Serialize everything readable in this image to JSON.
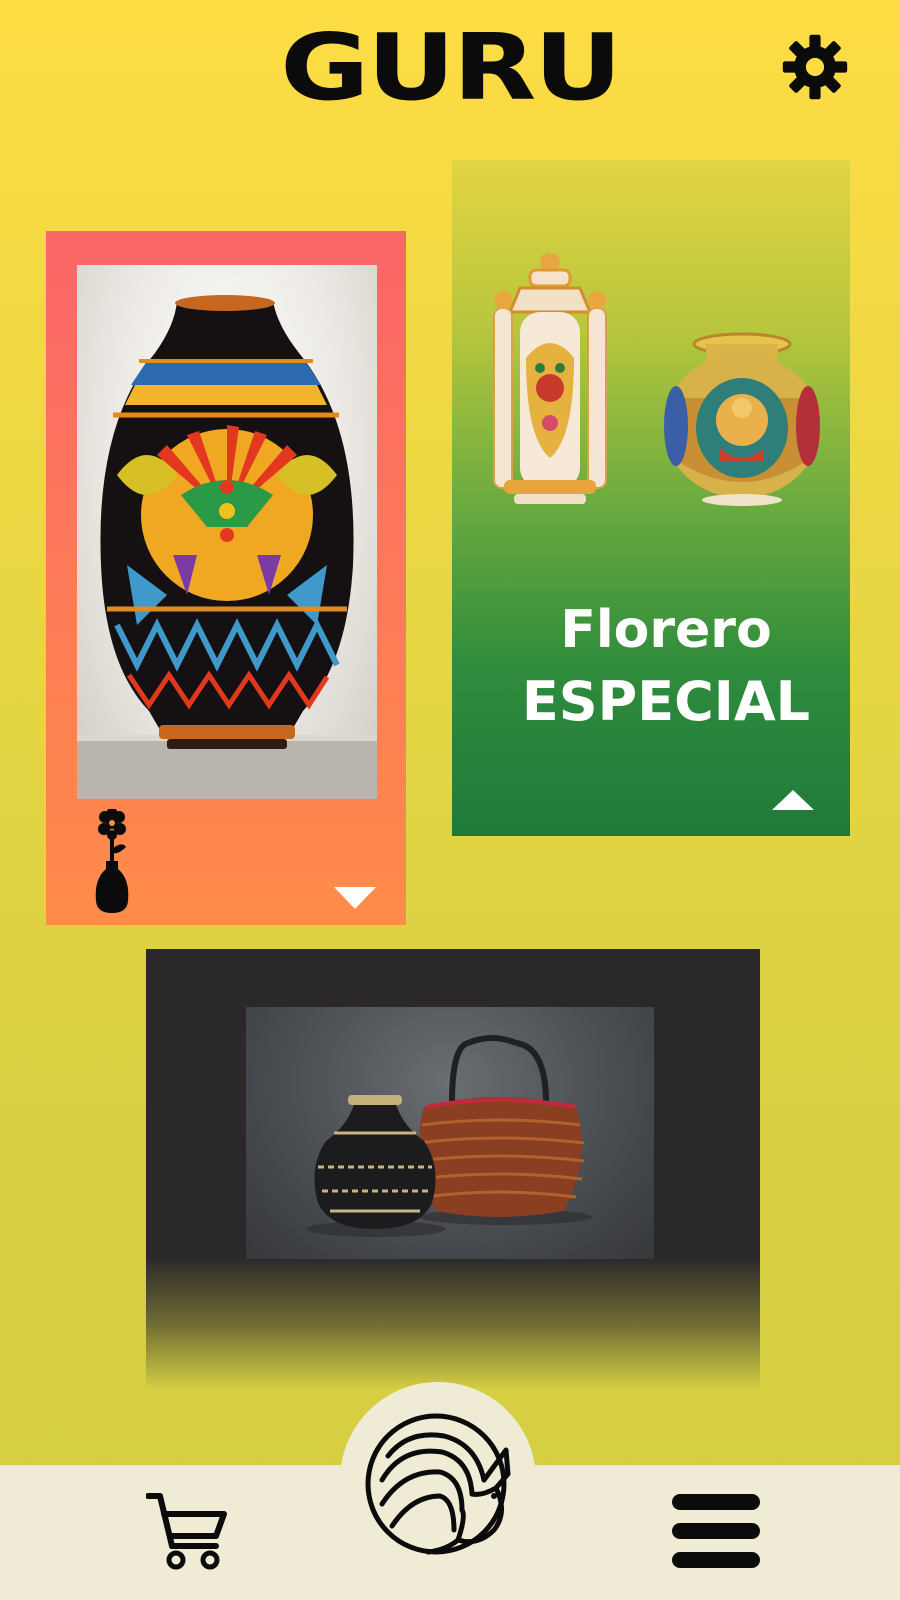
{
  "header": {
    "logo_text": "GURU",
    "settings_icon": "gear-icon"
  },
  "cards": [
    {
      "image": "painted-vase-photo",
      "icon": "flower-vase-icon",
      "toggle_icon": "triangle-down-icon",
      "colors": {
        "top": "#fb6669",
        "bottom": "#ff8c49"
      }
    },
    {
      "image": "decorated-lantern-and-pot-photo",
      "title_line1": "Florero",
      "title_line2": "ESPECIAL",
      "toggle_icon": "triangle-up-icon",
      "colors": {
        "top": "#e3d442",
        "bottom": "#1f7a3a"
      }
    },
    {
      "image": "woven-vase-and-basket-photo",
      "colors": {
        "background": "#2a2829"
      }
    }
  ],
  "bottom_nav": {
    "cart_icon": "cart-icon",
    "home_icon": "armadillo-logo-icon",
    "menu_icon": "hamburger-menu-icon",
    "bar_color": "#efebd5"
  },
  "theme": {
    "background_top": "#fedc44",
    "background_bottom": "#d4ce42",
    "ink": "#0b0b0b"
  }
}
